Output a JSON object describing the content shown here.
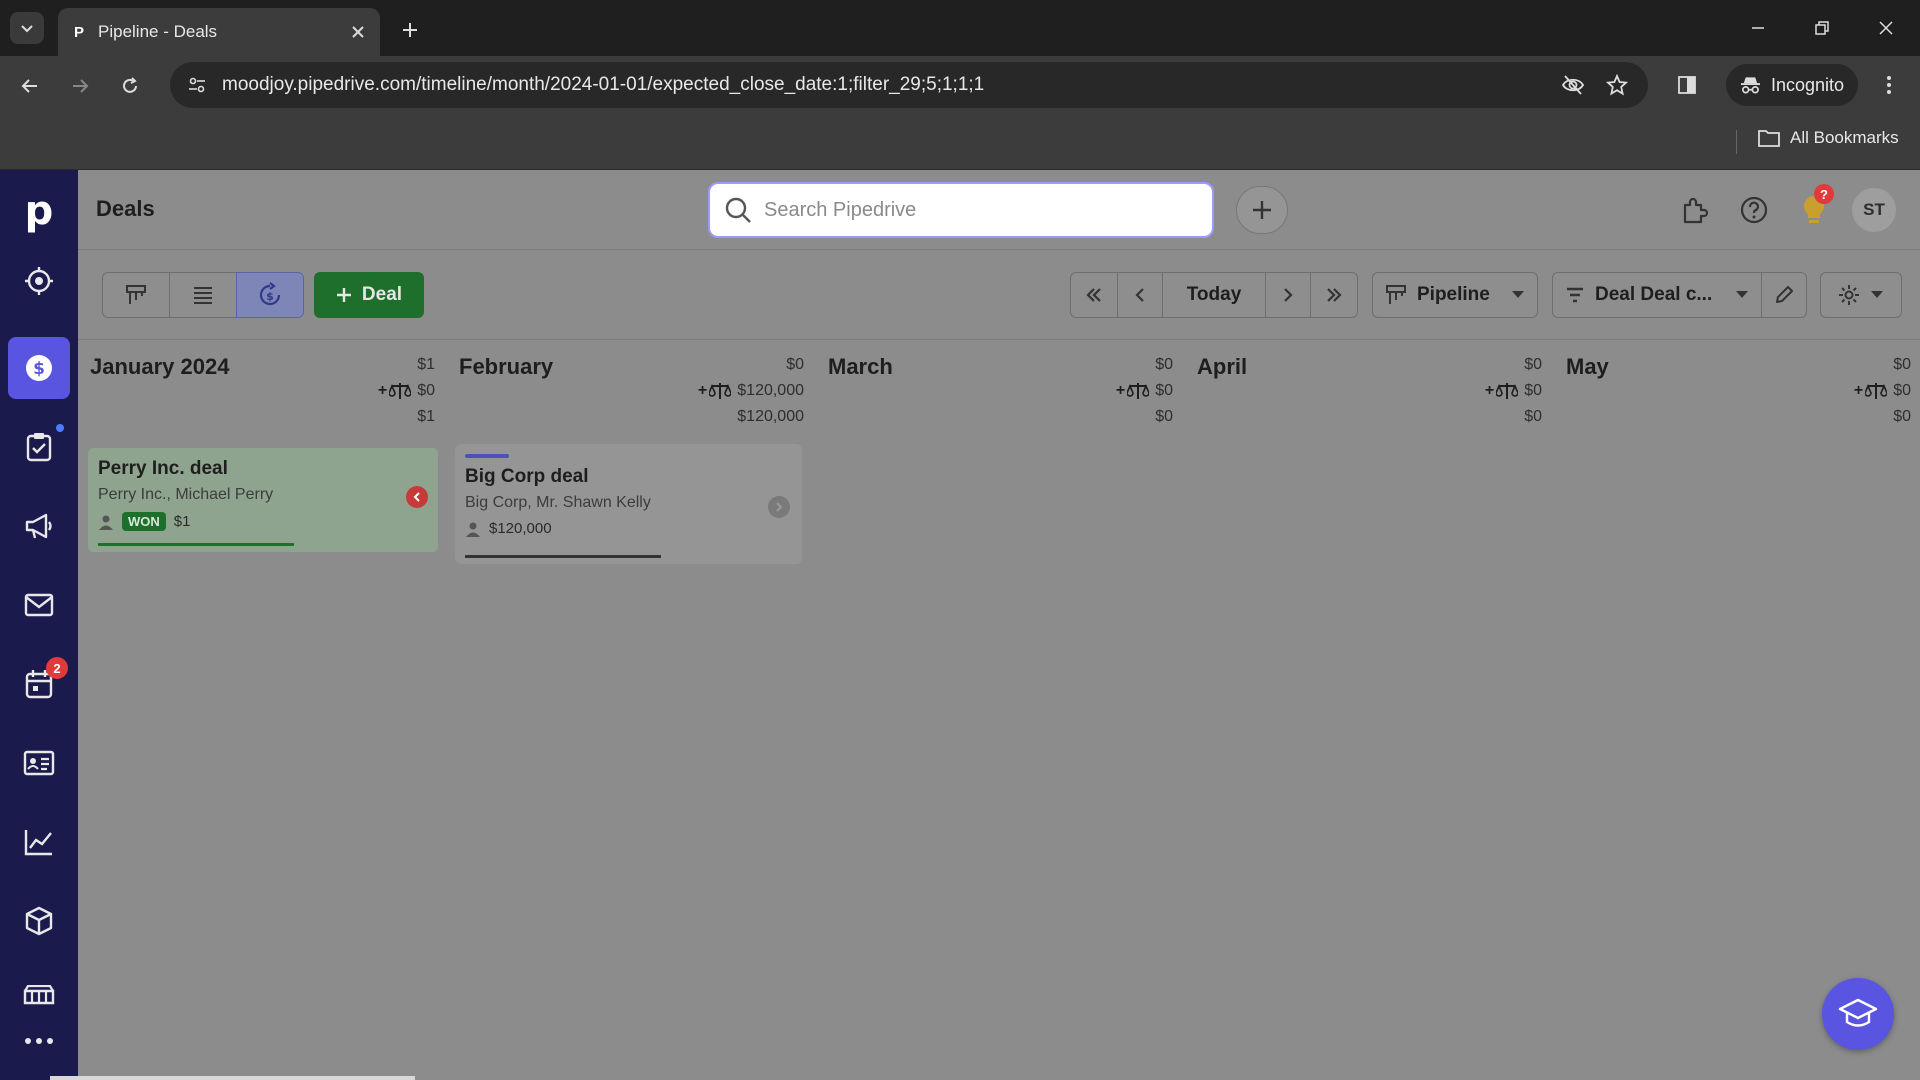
{
  "browser": {
    "tab_title": "Pipeline - Deals",
    "tab_favicon": "P",
    "url": "moodjoy.pipedrive.com/timeline/month/2024-01-01/expected_close_date:1;filter_29;5;1;1;1",
    "incognito_label": "Incognito",
    "bookmarks_label": "All Bookmarks"
  },
  "sidebar": {
    "logo": "p",
    "items": [
      {
        "icon": "target-icon",
        "active": false
      },
      {
        "icon": "dollar-icon",
        "active": true
      },
      {
        "icon": "task-icon",
        "active": false,
        "dot": true
      },
      {
        "icon": "megaphone-icon",
        "active": false
      },
      {
        "icon": "mail-icon",
        "active": false
      },
      {
        "icon": "calendar-icon",
        "active": false,
        "badge": "2"
      },
      {
        "icon": "contacts-icon",
        "active": false
      },
      {
        "icon": "chart-icon",
        "active": false
      },
      {
        "icon": "box-icon",
        "active": false
      },
      {
        "icon": "marketplace-icon",
        "active": false
      },
      {
        "icon": "more-icon",
        "active": false
      }
    ]
  },
  "header": {
    "title": "Deals",
    "search_placeholder": "Search Pipedrive",
    "notif_badge": "?",
    "avatar_initials": "ST"
  },
  "toolbar": {
    "add_deal_label": "Deal",
    "today_label": "Today",
    "pipeline_label": "Pipeline",
    "filter_label": "Deal Deal c..."
  },
  "months": [
    {
      "name": "January 2024",
      "total": "$1",
      "weighted_prefix": "+",
      "weighted": "$0",
      "sum": "$1"
    },
    {
      "name": "February",
      "total": "$0",
      "weighted_prefix": "+",
      "weighted": "$120,000",
      "sum": "$120,000"
    },
    {
      "name": "March",
      "total": "$0",
      "weighted_prefix": "+",
      "weighted": "$0",
      "sum": "$0"
    },
    {
      "name": "April",
      "total": "$0",
      "weighted_prefix": "+",
      "weighted": "$0",
      "sum": "$0"
    },
    {
      "name": "May",
      "total": "$0",
      "weighted_prefix": "+",
      "weighted": "$0",
      "sum": "$0"
    }
  ],
  "deals": [
    {
      "title": "Perry Inc. deal",
      "org": "Perry Inc., Michael Perry",
      "status": "WON",
      "value": "$1"
    },
    {
      "title": "Big Corp deal",
      "org": "Big Corp, Mr. Shawn Kelly",
      "value": "$120,000"
    }
  ],
  "colors": {
    "sidebar_bg": "#1b1a4d",
    "accent": "#5a55e0",
    "won_green": "#1e6e2c",
    "badge_red": "#e03a3a"
  }
}
